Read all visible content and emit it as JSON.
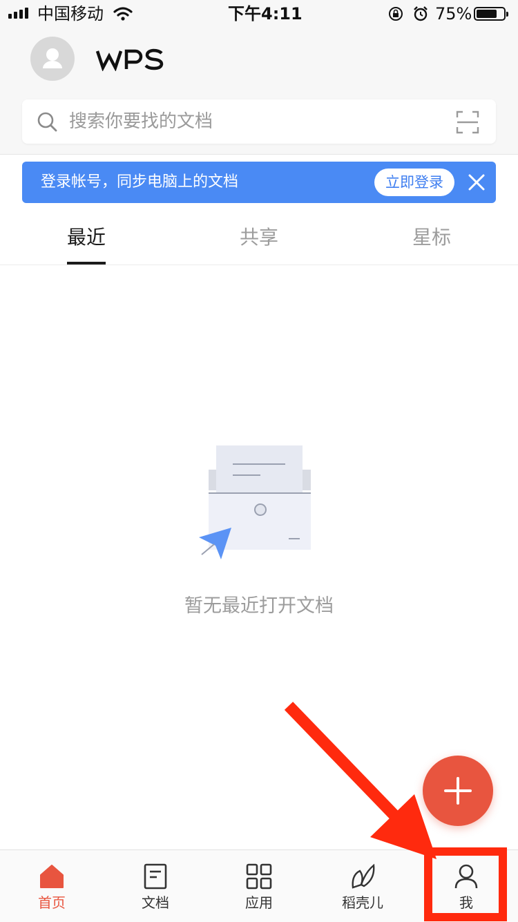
{
  "status_bar": {
    "carrier": "中国移动",
    "time": "下午4:11",
    "battery_percent": "75%",
    "battery_level": 0.75
  },
  "header": {
    "logo_text": "WPS",
    "search_placeholder": "搜索你要找的文档"
  },
  "banner": {
    "text": "登录帐号，同步电脑上的文档",
    "login_label": "立即登录",
    "color": "#4a8af4"
  },
  "tabs": [
    {
      "label": "最近",
      "active": true
    },
    {
      "label": "共享",
      "active": false
    },
    {
      "label": "星标",
      "active": false
    }
  ],
  "empty_state": {
    "message": "暂无最近打开文档"
  },
  "fab": {
    "icon": "plus-icon",
    "color": "#e8553f"
  },
  "bottom_nav": [
    {
      "label": "首页",
      "icon": "home-icon",
      "active": true
    },
    {
      "label": "文档",
      "icon": "document-icon",
      "active": false
    },
    {
      "label": "应用",
      "icon": "apps-grid-icon",
      "active": false
    },
    {
      "label": "稻壳儿",
      "icon": "leaf-icon",
      "active": false
    },
    {
      "label": "我",
      "icon": "user-icon",
      "active": false
    }
  ],
  "accent_color": "#e8553f",
  "annotation_color": "#ff2a0e"
}
